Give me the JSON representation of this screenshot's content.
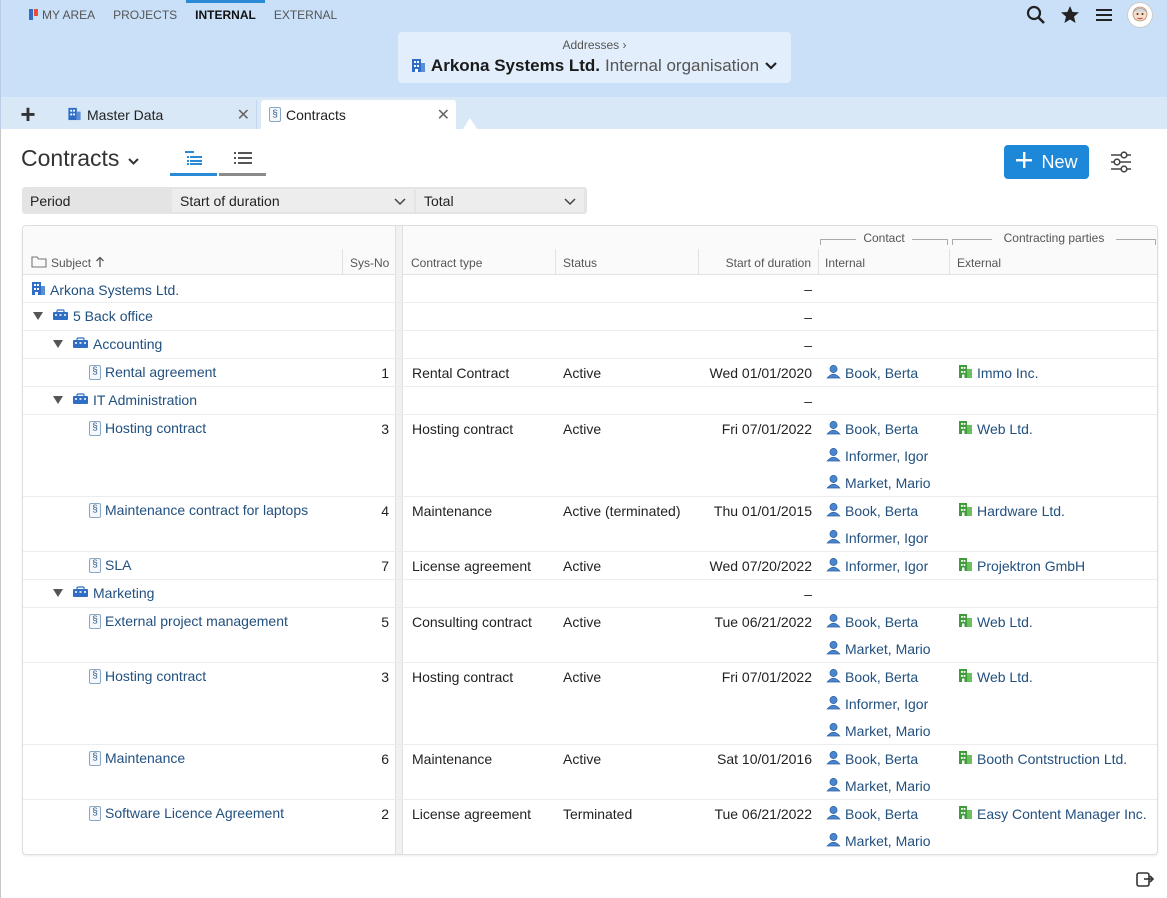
{
  "topnav": [
    {
      "label": "MY AREA",
      "active": false
    },
    {
      "label": "PROJECTS",
      "active": false
    },
    {
      "label": "INTERNAL",
      "active": true
    },
    {
      "label": "EXTERNAL",
      "active": false
    }
  ],
  "address_box": {
    "breadcrumb": "Addresses ›",
    "org_name": "Arkona Systems Ltd.",
    "org_type": "Internal organisation"
  },
  "tabs": [
    {
      "label": "Master Data",
      "icon": "building-icon"
    },
    {
      "label": "Contracts",
      "icon": "paragraph-icon"
    }
  ],
  "page": {
    "title": "Contracts",
    "new_button": "New"
  },
  "filters": {
    "period_label": "Period",
    "period_value": "Start of duration",
    "range_value": "Total"
  },
  "grid": {
    "headers": {
      "subject": "Subject",
      "sysno": "Sys-No",
      "contract_type": "Contract type",
      "status": "Status",
      "start": "Start of duration",
      "group_contact": "Contact",
      "internal": "Internal",
      "group_parties": "Contracting parties",
      "external": "External"
    },
    "rows": [
      {
        "kind": "org",
        "level": 0,
        "subject": "Arkona Systems Ltd.",
        "start": "–"
      },
      {
        "kind": "dept",
        "level": 1,
        "subject": "5 Back office",
        "start": "–"
      },
      {
        "kind": "dept",
        "level": 2,
        "subject": "Accounting",
        "start": "–"
      },
      {
        "kind": "contract",
        "level": 3,
        "subject": "Rental agreement",
        "sysno": "1",
        "type": "Rental Contract",
        "status": "Active",
        "start": "Wed 01/01/2020",
        "internal": [
          "Book, Berta"
        ],
        "external": "Immo Inc."
      },
      {
        "kind": "dept",
        "level": 2,
        "subject": "IT Administration",
        "start": "–"
      },
      {
        "kind": "contract",
        "level": 3,
        "subject": "Hosting contract",
        "sysno": "3",
        "type": "Hosting contract",
        "status": "Active",
        "start": "Fri 07/01/2022",
        "internal": [
          "Book, Berta",
          "Informer, Igor",
          "Market, Mario"
        ],
        "external": "Web Ltd."
      },
      {
        "kind": "contract",
        "level": 3,
        "subject": "Maintenance contract for laptops",
        "sysno": "4",
        "type": "Maintenance",
        "status": "Active (terminated)",
        "start": "Thu 01/01/2015",
        "internal": [
          "Book, Berta",
          "Informer, Igor"
        ],
        "external": "Hardware Ltd."
      },
      {
        "kind": "contract",
        "level": 3,
        "subject": "SLA",
        "sysno": "7",
        "type": "License agreement",
        "status": "Active",
        "start": "Wed 07/20/2022",
        "internal": [
          "Informer, Igor"
        ],
        "external": "Projektron GmbH"
      },
      {
        "kind": "dept",
        "level": 2,
        "subject": "Marketing",
        "start": "–"
      },
      {
        "kind": "contract",
        "level": 3,
        "subject": "External project management",
        "sysno": "5",
        "type": "Consulting contract",
        "status": "Active",
        "start": "Tue 06/21/2022",
        "internal": [
          "Book, Berta",
          "Market, Mario"
        ],
        "external": "Web Ltd."
      },
      {
        "kind": "contract",
        "level": 3,
        "subject": "Hosting contract",
        "sysno": "3",
        "type": "Hosting contract",
        "status": "Active",
        "start": "Fri 07/01/2022",
        "internal": [
          "Book, Berta",
          "Informer, Igor",
          "Market, Mario"
        ],
        "external": "Web Ltd."
      },
      {
        "kind": "contract",
        "level": 3,
        "subject": "Maintenance",
        "sysno": "6",
        "type": "Maintenance",
        "status": "Active",
        "start": "Sat 10/01/2016",
        "internal": [
          "Book, Berta",
          "Market, Mario"
        ],
        "external": "Booth Contstruction Ltd."
      },
      {
        "kind": "contract",
        "level": 3,
        "subject": "Software Licence Agreement",
        "sysno": "2",
        "type": "License agreement",
        "status": "Terminated",
        "start": "Tue 06/21/2022",
        "internal": [
          "Book, Berta",
          "Market, Mario"
        ],
        "external": "Easy Content Manager Inc."
      }
    ]
  },
  "colors": {
    "accent": "#1e88d8",
    "topband": "#c9e0f8",
    "link": "#22507f"
  }
}
